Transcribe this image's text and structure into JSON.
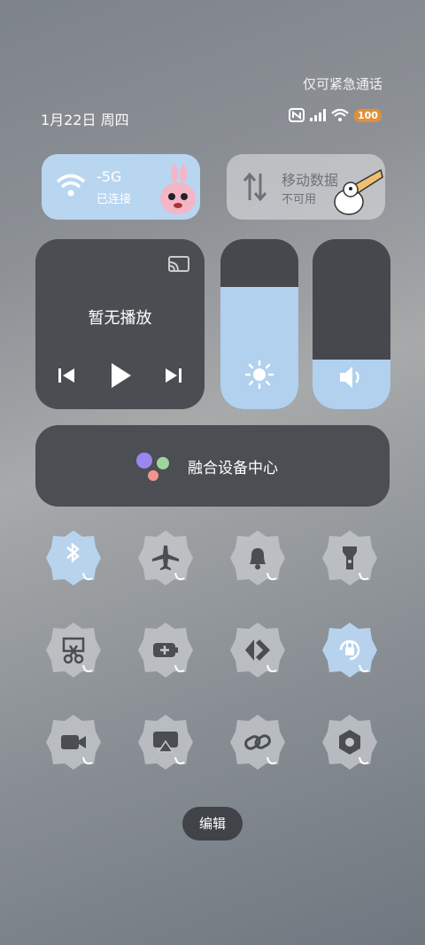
{
  "status_bar": {
    "emergency_text": "仅可紧急通话",
    "date": "1月22日 周四",
    "battery": "100"
  },
  "tiles": {
    "wifi": {
      "title": "-5G",
      "subtitle": "已连接",
      "active": true
    },
    "mobile_data": {
      "title": "移动数据",
      "subtitle": "不可用",
      "active": false
    }
  },
  "media": {
    "title": "暂无播放"
  },
  "sliders": {
    "brightness": 0.72,
    "volume": 0.29
  },
  "device_hub": {
    "label": "融合设备中心"
  },
  "toggles": [
    {
      "name": "bluetooth-toggle",
      "icon": "bluetooth-icon",
      "active": true
    },
    {
      "name": "airplane-toggle",
      "icon": "airplane-icon",
      "active": false
    },
    {
      "name": "bell-toggle",
      "icon": "bell-icon",
      "active": false
    },
    {
      "name": "flashlight-toggle",
      "icon": "flashlight-icon",
      "active": false
    },
    {
      "name": "screenshot-toggle",
      "icon": "scissors-icon",
      "active": false
    },
    {
      "name": "battery-saver-toggle",
      "icon": "battery-plus-icon",
      "active": false
    },
    {
      "name": "share-toggle",
      "icon": "share-icon",
      "active": false
    },
    {
      "name": "rotation-lock-toggle",
      "icon": "rotation-lock-icon",
      "active": true
    },
    {
      "name": "screen-record-toggle",
      "icon": "video-icon",
      "active": false
    },
    {
      "name": "projection-toggle",
      "icon": "screencast-icon",
      "active": false
    },
    {
      "name": "link-toggle",
      "icon": "link-icon",
      "active": false
    },
    {
      "name": "nfc-hex-toggle",
      "icon": "hex-nut-icon",
      "active": false
    }
  ],
  "edit_button": {
    "label": "编辑"
  },
  "colors": {
    "active": "#b9d6f0",
    "inactive": "#c4c8cc",
    "dark_tile": "#4a4d51"
  }
}
